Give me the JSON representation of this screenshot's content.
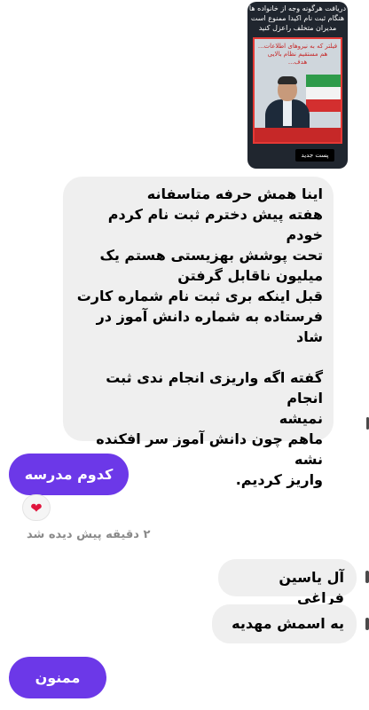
{
  "post": {
    "caption": "دریافت هرگونه وجه از خانواده ها\nهنگام ثبت نام اکیدا ممنوع است\nمدیران متخلف راعزل کنید",
    "headline": "فیلتر که به نیروهای اطلاعات...\nهم مستقیم نظام بالایی\nهدف...",
    "tag": "پست جدید"
  },
  "messages": {
    "received_long": "اینا همش حرفه متاسفانه\nهفته پیش دخترم ثبت نام کردم خودم\nتحت پوشش بهزیستی هستم یک\nمیلیون ناقابل گرفتن\nقبل اینکه بری ثبت نام شماره کارت\nفرستاده به شماره دانش آموز در شاد\n\nگفته اگه واریزی انجام ندی ثبت انجام\nنمیشه\nماهم چون دانش آموز سر افکنده نشه\nواریز کردیم.",
    "sent_school": "کدوم مدرسه",
    "reaction": "❤",
    "seen": "۲ دقیقه پیش دیده شد",
    "received_name": "آل یاسین فراغی",
    "received_mahdiyeh": "یه اسمش مهدیه",
    "sent_thanks": "ممنون"
  },
  "colors": {
    "sent_bubble": "#6c38e8",
    "received_bubble": "#efefef"
  }
}
